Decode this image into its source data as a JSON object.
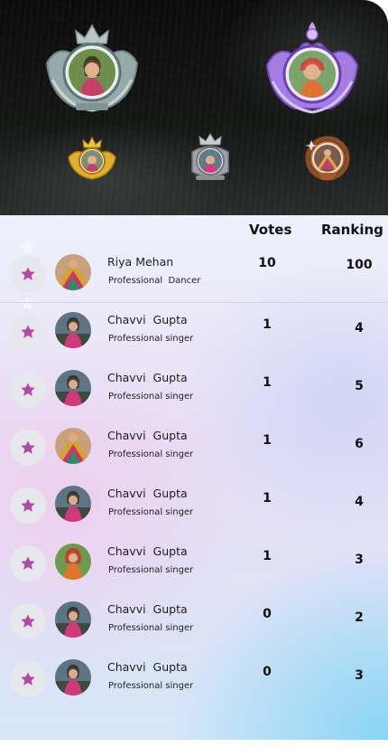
{
  "podium": [
    {
      "rank_name": "first-place-badge",
      "frame_color": "#8fa3a6"
    },
    {
      "rank_name": "second-place-badge",
      "frame_color": "#9b6ad6"
    },
    {
      "rank_name": "third-place-badge",
      "frame_color": "#d7a321"
    },
    {
      "rank_name": "fourth-place-badge",
      "frame_color": "#8e9196"
    },
    {
      "rank_name": "fifth-place-badge",
      "frame_color": "#a35a2a"
    }
  ],
  "table": {
    "votes_header": "Votes",
    "ranking_header": "Ranking"
  },
  "rows": [
    {
      "name": "Riya Mehan",
      "role": "Professional  Dancer",
      "votes": "10",
      "ranking": "100"
    },
    {
      "name": "Chavvi  Gupta",
      "role": "Professional singer",
      "votes": "1",
      "ranking": "4"
    },
    {
      "name": "Chavvi  Gupta",
      "role": "Professional singer",
      "votes": "1",
      "ranking": "5"
    },
    {
      "name": "Chavvi  Gupta",
      "role": "Professional singer",
      "votes": "1",
      "ranking": "6"
    },
    {
      "name": "Chavvi  Gupta",
      "role": "Professional singer",
      "votes": "1",
      "ranking": "4"
    },
    {
      "name": "Chavvi  Gupta",
      "role": "Professional singer",
      "votes": "1",
      "ranking": "3"
    },
    {
      "name": "Chavvi  Gupta",
      "role": "Professional singer",
      "votes": "0",
      "ranking": "2"
    },
    {
      "name": "Chavvi  Gupta",
      "role": "Professional singer",
      "votes": "0",
      "ranking": "3"
    }
  ],
  "icons": {
    "star": "star-icon",
    "avatar": "avatar"
  },
  "colors": {
    "star": "#b14aa0",
    "star_button_bg": "#e7e8ee"
  }
}
